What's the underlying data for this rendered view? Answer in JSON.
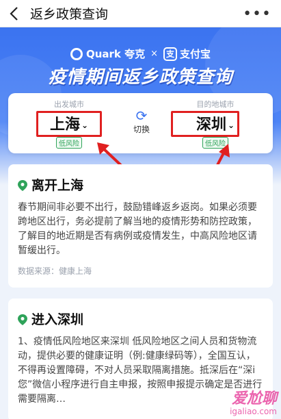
{
  "nav": {
    "title": "返乡政策查询",
    "more_icon": "more-dots-icon"
  },
  "hero": {
    "brand_left": "Quark 夸克",
    "brand_sep": "×",
    "brand_right": "支付宝",
    "title": "疫情期间返乡政策查询"
  },
  "city_select": {
    "from": {
      "hint": "出发城市",
      "city": "上海",
      "risk": "低风险"
    },
    "to": {
      "hint": "目的地城市",
      "city": "深圳",
      "risk": "低风险"
    },
    "switch_label": "切换"
  },
  "leave_card": {
    "title": "离开上海",
    "body": "春节期间非必要不出行，鼓励错峰返乡返岗。如果必须要跨地区出行，务必提前了解当地的疫情形势和防控政策，了解目的地近期是否有病例或疫情发生，中高风险地区请暂缓出行。",
    "source": "数据来源：健康上海"
  },
  "enter_card": {
    "title": "进入深圳",
    "body": "1、疫情低风险地区来深圳 低风险地区之间人员和货物流动，提供必要的健康证明（例:健康绿码等），全国互认，不得再设置障碍，不对人员采取隔离措施。抵深后在“深i您”微信小程序进行自主申报，按照申报提示确定是否进行需要隔离…"
  },
  "watermark": {
    "line1": "爱尬聊",
    "line2": "igaliao.com"
  },
  "colors": {
    "accent": "#3b73f0",
    "highlight": "#e02020",
    "risk_green": "#2fa35a"
  }
}
